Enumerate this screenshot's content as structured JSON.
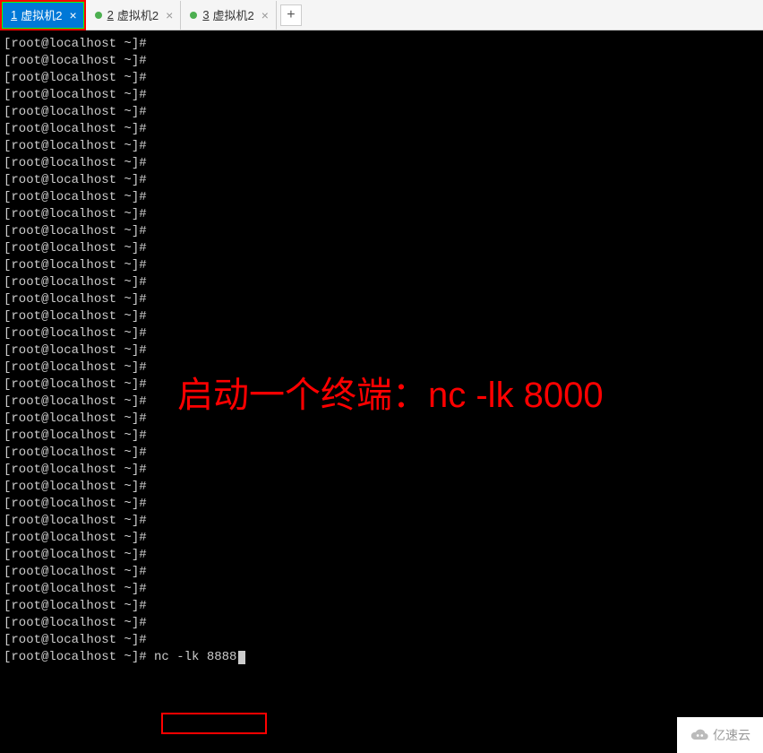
{
  "tabs": [
    {
      "num": "1",
      "label": "虚拟机2",
      "active": true,
      "hasDot": false
    },
    {
      "num": "2",
      "label": "虚拟机2",
      "active": false,
      "hasDot": true
    },
    {
      "num": "3",
      "label": "虚拟机2",
      "active": false,
      "hasDot": true
    }
  ],
  "addTab": "+",
  "closeSymbol": "×",
  "terminal": {
    "prompt": "[root@localhost ~]#",
    "promptCount": 36,
    "command": "nc -lk 8888"
  },
  "annotation": "启动一个终端：nc -lk 8000",
  "watermark": "亿速云"
}
